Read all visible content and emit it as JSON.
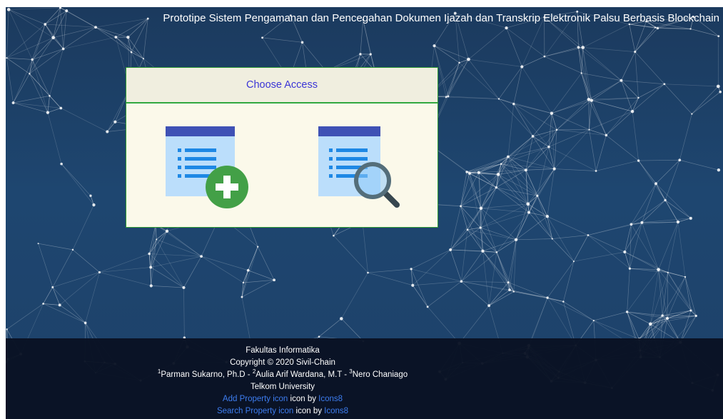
{
  "header": {
    "title": "Prototipe Sistem Pengamanan dan Pencegahan Dokumen Ijazah dan Transkrip Elektronik Palsu Berbasis Blockchain"
  },
  "panel": {
    "title": "Choose Access",
    "options": [
      {
        "icon": "add-property-icon"
      },
      {
        "icon": "search-property-icon"
      }
    ]
  },
  "footer": {
    "faculty": "Fakultas Informatika",
    "copyright": "Copyright © 2020 Sivil-Chain",
    "authors": [
      {
        "sup": "1",
        "name": "Parman Sukarno, Ph.D - "
      },
      {
        "sup": "2",
        "name": "Aulia Arif Wardana, M.T - "
      },
      {
        "sup": "3",
        "name": "Nero Chaniago"
      }
    ],
    "university": "Telkom University",
    "credits": [
      {
        "link": "Add Property icon",
        "middle": " icon by ",
        "by": "Icons8"
      },
      {
        "link": "Search Property icon",
        "middle": " icon by ",
        "by": "Icons8"
      }
    ]
  },
  "colors": {
    "background": "#1d4169",
    "footer": "#0a1526",
    "panel_border": "#32a840",
    "title_link": "#3b35d6",
    "credit_link": "#3d7df0",
    "icon_blue": "#3f51b5",
    "icon_light": "#bbdefb",
    "icon_green": "#43a047"
  }
}
